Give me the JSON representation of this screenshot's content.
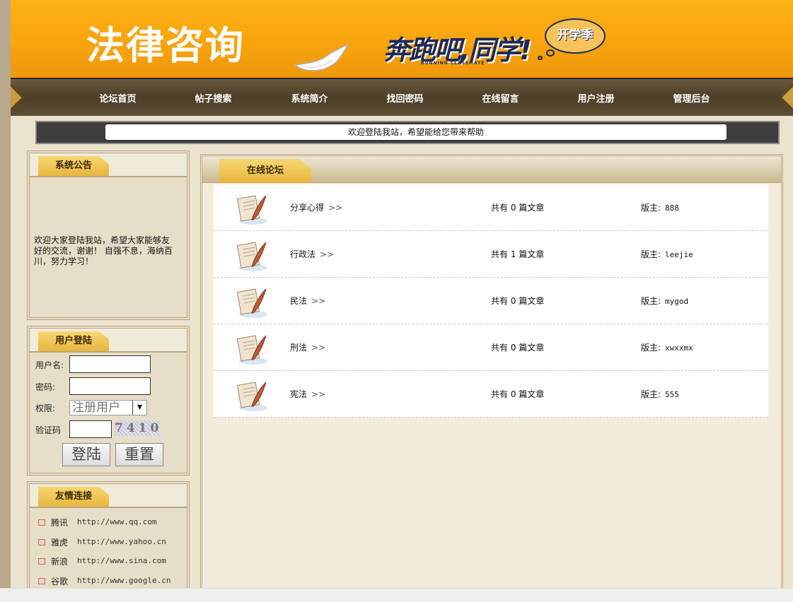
{
  "header": {
    "site_title": "法律咨询",
    "slogan": "奔跑吧,同学!",
    "slogan_sub": "RUNNING  CLASSMATE",
    "bubble": "开学季"
  },
  "nav": {
    "items": [
      "论坛首页",
      "帖子搜索",
      "系统简介",
      "找回密码",
      "在线留言",
      "用户注册",
      "管理后台"
    ]
  },
  "welcome": "欢迎登陆我站，希望能给您带来帮助",
  "notice": {
    "title": "系统公告",
    "text": "欢迎大家登陆我站，希望大家能够友好的交流，谢谢！ 自强不息，海纳百川，努力学习！"
  },
  "login": {
    "title": "用户登陆",
    "username_label": "用户名:",
    "username_value": "",
    "password_label": "密码:",
    "password_value": "",
    "role_label": "权限:",
    "role_selected": "注册用户",
    "captcha_label": "验证码",
    "captcha_value": "",
    "captcha_image_text": "7410",
    "login_button": "登陆",
    "reset_button": "重置"
  },
  "links": {
    "title": "友情连接",
    "items": [
      {
        "name": "腾讯",
        "url": "http://www.qq.com"
      },
      {
        "name": "雅虎",
        "url": "http://www.yahoo.cn"
      },
      {
        "name": "新浪",
        "url": "http://www.sina.com"
      },
      {
        "name": "谷歌",
        "url": "http://www.google.cn"
      }
    ]
  },
  "forum": {
    "title": "在线论坛",
    "arrow": ">>",
    "count_prefix": "共有",
    "count_suffix": "篇文章",
    "admin_label": "版主:",
    "boards": [
      {
        "name": "分享心得",
        "count": "0",
        "admin": "888"
      },
      {
        "name": "行政法",
        "count": "1",
        "admin": "leejie"
      },
      {
        "name": "民法",
        "count": "0",
        "admin": "mygod"
      },
      {
        "name": "刑法",
        "count": "0",
        "admin": "xwxxmx"
      },
      {
        "name": "宪法",
        "count": "0",
        "admin": "555"
      }
    ]
  },
  "colors": {
    "banner": "#f7a30e",
    "nav": "#4b3d27",
    "tab": "#e7b63d",
    "page_bg": "#ece3cf"
  }
}
